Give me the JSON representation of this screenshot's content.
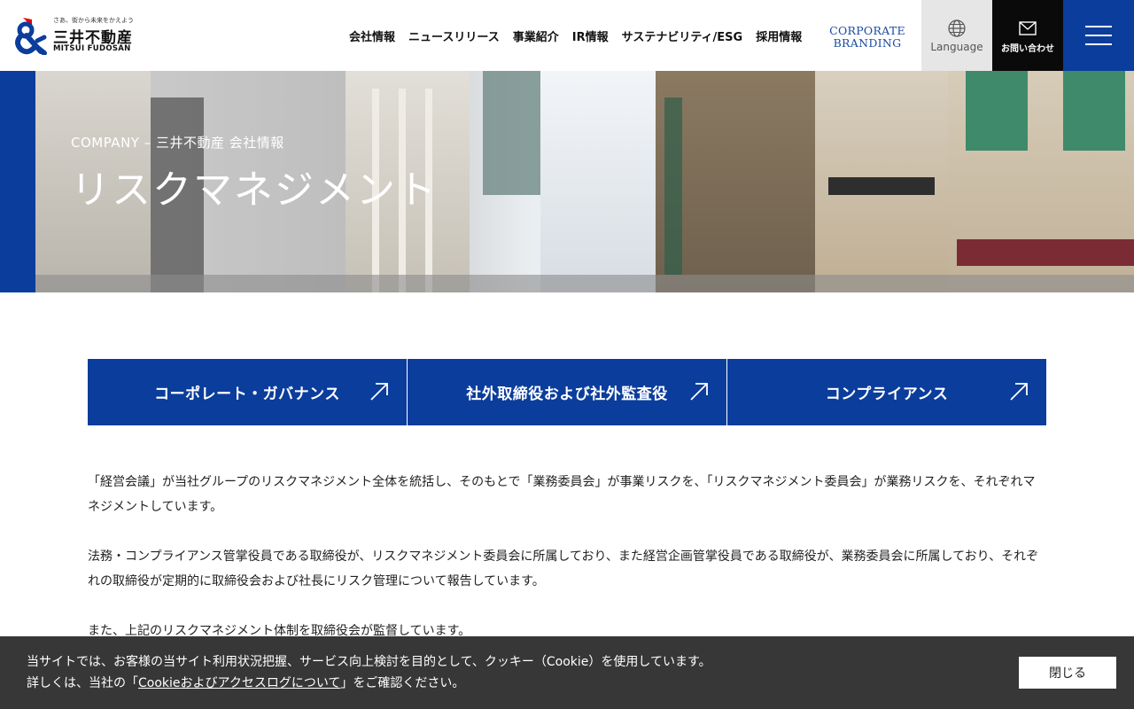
{
  "logo": {
    "tagline": "さあ、街から未来をかえよう",
    "name_ja": "三井不動産",
    "name_en": "MITSUI FUDOSAN"
  },
  "nav": {
    "items": [
      {
        "label": "会社情報"
      },
      {
        "label": "ニュースリリース"
      },
      {
        "label": "事業紹介"
      },
      {
        "label": "IR情報"
      },
      {
        "label": "サステナビリティ/ESG"
      },
      {
        "label": "採用情報"
      }
    ],
    "branding_line1": "CORPORATE",
    "branding_line2": "BRANDING",
    "language_label": "Language",
    "contact_label": "お問い合わせ"
  },
  "hero": {
    "subtitle": "COMPANY – 三井不動産 会社情報",
    "title": "リスクマネジメント"
  },
  "links": [
    {
      "label": "コーポレート・ガバナンス"
    },
    {
      "label": "社外取締役および社外監査役"
    },
    {
      "label": "コンプライアンス"
    }
  ],
  "content": {
    "paragraphs": [
      "「経営会議」が当社グループのリスクマネジメント全体を統括し、そのもとで「業務委員会」が事業リスクを、「リスクマネジメント委員会」が業務リスクを、それぞれマネジメントしています。",
      "法務・コンプライアンス管掌役員である取締役が、リスクマネジメント委員会に所属しており、また経営企画管掌役員である取締役が、業務委員会に所属しており、それぞれの取締役が定期的に取締役会および社長にリスク管理について報告しています。",
      "また、上記のリスクマネジメント体制を取締役会が監督しています。"
    ]
  },
  "cookie": {
    "line1": "当サイトでは、お客様の当サイト利用状況把握、サービス向上検討を目的として、クッキー（Cookie）を使用しています。",
    "line2_prefix": "詳しくは、当社の「",
    "line2_link": "Cookieおよびアクセスログについて",
    "line2_suffix": "」をご確認ください。",
    "close_label": "閉じる"
  },
  "colors": {
    "brand_blue": "#0b3d9c",
    "brand_red": "#e60012",
    "cookie_bg": "#2c2c2c"
  }
}
